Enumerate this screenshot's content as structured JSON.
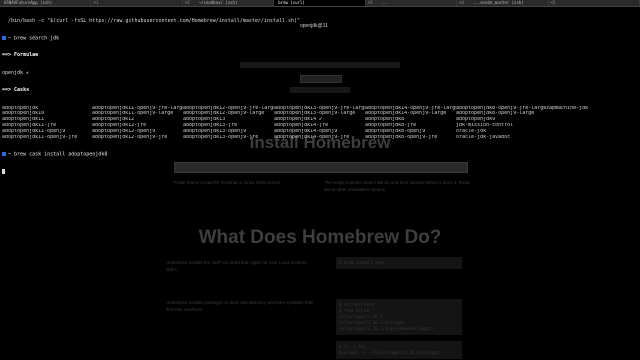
{
  "tabs": [
    {
      "shortcut": "",
      "title": "USNAVFutureApp (zsh)"
    },
    {
      "shortcut": "⌘1",
      "title": ""
    },
    {
      "shortcut": "⌘2",
      "title": "~/sandbox/ (zsh)"
    },
    {
      "shortcut": "",
      "title": "brew (curl)"
    },
    {
      "shortcut": "⌘3",
      "title": "..."
    },
    {
      "shortcut": "⌘4",
      "title": "...ecode_master (zsh)"
    },
    {
      "shortcut": "⌘5",
      "title": ""
    }
  ],
  "active_tab_index": 3,
  "terminal": {
    "line1": "/bin/bash -c \"$(curl -fsSL https://raw.githubusercontent.com/Homebrew/install/master/install.sh)\"",
    "line2_prompt": "~",
    "line2_cmd": "brew search jdk",
    "formulae_header": "==> Formulae",
    "formula": "openjdk ✔",
    "casks_header": "==> Casks",
    "casks_rows": [
      [
        "adoptopenjdk",
        "adoptopenjdk11-openj9-jre-large",
        "adoptopenjdk12-openj9-jre-large",
        "adoptopenjdk13-openj9-jre-large",
        "adoptopenjdk14-openj9-jre-large",
        "adoptopenjdk8-openj9-jre-large",
        "zapmachine-jdk"
      ],
      [
        "adoptopenjdk10",
        "adoptopenjdk11-openj9-large",
        "adoptopenjdk12-openj9-large",
        "adoptopenjdk13-openj9-large",
        "adoptopenjdk14-openj9-large",
        "adoptopenjdk8-openj9-large",
        ""
      ],
      [
        "adoptopenjdk11",
        "adoptopenjdk12",
        "adoptopenjdk13",
        "adoptopenjdk14 ✔",
        "adoptopenjdk8",
        "adoptopenjdk9",
        ""
      ],
      [
        "adoptopenjdk11-jre",
        "adoptopenjdk12-jre",
        "adoptopenjdk13-jre",
        "adoptopenjdk14-jre",
        "adoptopenjdk8-jre",
        "jdk-mission-control",
        ""
      ],
      [
        "adoptopenjdk11-openj9",
        "adoptopenjdk12-openj9",
        "adoptopenjdk13-openj9",
        "adoptopenjdk14-openj9",
        "adoptopenjdk8-openj9",
        "oracle-jdk",
        ""
      ],
      [
        "adoptopenjdk11-openj9-jre",
        "adoptopenjdk12-openj9-jre",
        "adoptopenjdk13-openj9-jre",
        "adoptopenjdk14-openj9-jre",
        "adoptopenjdk8-openj9-jre",
        "oracle-jdk-javadoc",
        ""
      ]
    ],
    "last_prompt": "~",
    "last_cmd": "brew cask install adoptopenjdk8",
    "overlay": "openjdk@11"
  },
  "webpage": {
    "install_heading": "Install Homebrew",
    "does_heading": "What Does Homebrew Do?",
    "para1": "Paste that in a macOS Terminal or Linux shell prompt.",
    "para2": "The script explains what it will do and then pauses before it does it. Read about other installation options.",
    "para3": "Homebrew installs the stuff you need that Apple (or your Linux system) didn't.",
    "para4": "Homebrew installs packages to their own directory and then symlinks their files into /usr/local.",
    "code1": "$ brew install wget",
    "code2": "$ cd /usr/local\n$ find Cellar\nCellar/wget/1.16.1\nCellar/wget/1.16.1/bin/wget\nCellar/wget/1.16.1/share/man/man1/wget.1",
    "code3": "$ ls -l bin\nbin/wget -> ../Cellar/wget/1.16.1/bin/wget"
  }
}
